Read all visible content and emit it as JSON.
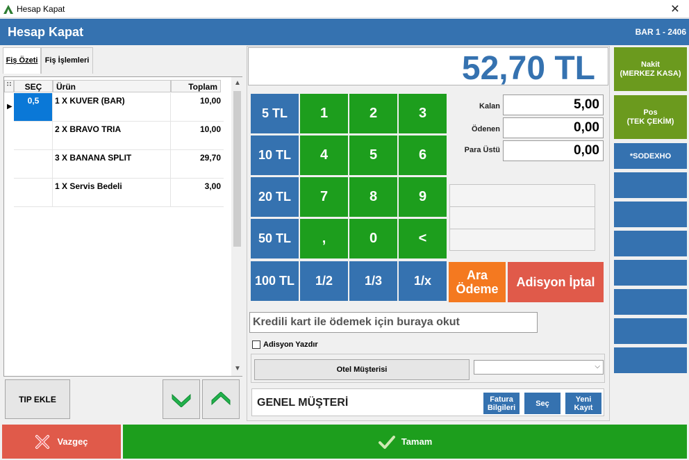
{
  "window": {
    "title": "Hesap Kapat",
    "close_glyph": "✕"
  },
  "header": {
    "title": "Hesap Kapat",
    "table": "BAR 1 - 2406"
  },
  "tabs": [
    {
      "label": "Fiş Özeti"
    },
    {
      "label": "Fiş İşlemleri"
    }
  ],
  "grid": {
    "columns": {
      "sec": "SEÇ",
      "urun": "Ürün",
      "toplam": "Toplam"
    },
    "rows": [
      {
        "sec": "0,5",
        "urun": "1 X KUVER (BAR)",
        "toplam": "10,00"
      },
      {
        "sec": "",
        "urun": "2 X BRAVO TRIA",
        "toplam": "10,00"
      },
      {
        "sec": "",
        "urun": "3 X BANANA SPLIT",
        "toplam": "29,70"
      },
      {
        "sec": "",
        "urun": "1 X Servis Bedeli",
        "toplam": "3,00"
      }
    ]
  },
  "bottom_left": {
    "tip_label": "TIP EKLE"
  },
  "total": "52,70 TL",
  "numpad": {
    "amounts": [
      "5 TL",
      "10 TL",
      "20 TL",
      "50 TL",
      "100 TL"
    ],
    "digits": [
      "1",
      "2",
      "3",
      "4",
      "5",
      "6",
      "7",
      "8",
      "9",
      ",",
      "0",
      "<"
    ],
    "fractions": [
      "1/2",
      "1/3",
      "1/x"
    ]
  },
  "fields": {
    "kalan_label": "Kalan",
    "kalan_value": "5,00",
    "odenen_label": "Ödenen",
    "odenen_value": "0,00",
    "para_ustu_label": "Para Üstü",
    "para_ustu_value": "0,00"
  },
  "ara_odeme": {
    "line1": "Ara",
    "line2": "Ödeme"
  },
  "adisyon_iptal": "Adisyon İptal",
  "scan_placeholder": "Kredili kart ile ödemek için buraya okut",
  "adisyon_yazdir": "Adisyon Yazdır",
  "otel_musterisi": "Otel Müşterisi",
  "customer": {
    "name": "GENEL MÜŞTERİ",
    "fatura_1": "Fatura",
    "fatura_2": "Bilgileri",
    "sec": "Seç",
    "yeni_1": "Yeni",
    "yeni_2": "Kayıt"
  },
  "payment_methods": [
    {
      "line1": "Nakit",
      "line2": "(MERKEZ KASA)"
    },
    {
      "line1": "Pos",
      "line2": "(TEK ÇEKİM)"
    },
    {
      "line1": "*SODEXHO",
      "line2": ""
    }
  ],
  "footer": {
    "cancel": "Vazgeç",
    "ok": "Tamam"
  },
  "colors": {
    "brand_blue": "#3572b0",
    "green": "#1d9e1d",
    "orange": "#f47920",
    "red": "#e05a4a",
    "olive": "#6b9a1e"
  }
}
